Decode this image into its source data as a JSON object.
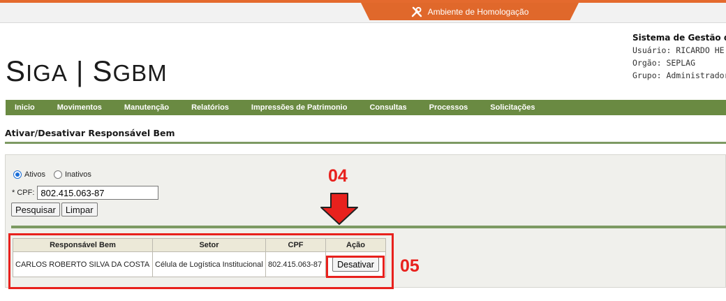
{
  "environment": {
    "label": "Ambiente de Homologação",
    "icon": "tools-icon",
    "color": "#e0682b"
  },
  "logo": {
    "part1_big": "S",
    "part1_small": "IGA",
    "sep": " | ",
    "part2_big": "S",
    "part2_small": "GBM"
  },
  "system_info": {
    "title": "Sistema de Gestão d",
    "user": "Usuário: RICARDO HE",
    "org": "Orgão: SEPLAG",
    "group": "Grupo: Administrador"
  },
  "menu": {
    "items": [
      "Inicio",
      "Movimentos",
      "Manutenção",
      "Relatórios",
      "Impressões de Patrimonio",
      "Consultas",
      "Processos",
      "Solicitações"
    ]
  },
  "page": {
    "title": "Ativar/Desativar Responsável Bem"
  },
  "filter": {
    "radio_active": "Ativos",
    "radio_inactive": "Inativos",
    "selected": "Ativos",
    "cpf_label": "* CPF:",
    "cpf_value": "802.415.063-87",
    "search_button": "Pesquisar",
    "clear_button": "Limpar"
  },
  "results": {
    "headers": [
      "Responsável Bem",
      "Setor",
      "CPF",
      "Ação"
    ],
    "rows": [
      {
        "name": "CARLOS ROBERTO SILVA DA COSTA",
        "sector": "Célula de Logística Institucional",
        "cpf": "802.415.063-87",
        "action": "Desativar"
      }
    ]
  },
  "annotations": {
    "step_04": "04",
    "step_05": "05",
    "color": "#e8211d"
  }
}
